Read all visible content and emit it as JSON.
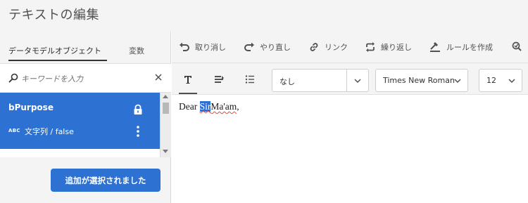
{
  "window": {
    "title": "テキストの編集"
  },
  "left_panel": {
    "tabs": [
      {
        "label": "データモデルオブジェクト",
        "active": true
      },
      {
        "label": "変数",
        "active": false
      }
    ],
    "search": {
      "placeholder": "キーワードを入力",
      "value": ""
    },
    "items": [
      {
        "name": "bPurpose",
        "type_icon": "ABC",
        "type": "文字列 / false",
        "selected": true
      }
    ],
    "add_button": "追加が選択されました"
  },
  "toolbar": {
    "undo": "取り消し",
    "redo": "やり直し",
    "link": "リンク",
    "repeat": "繰り返し",
    "create_rule": "ルールを作成"
  },
  "format_bar": {
    "style_value": "なし",
    "font_value": "Times New Roman",
    "size_value": "12"
  },
  "editor": {
    "before": "Dear ",
    "selected": "Sir",
    "after_misspelled": "Ma'am",
    "after_plain": ","
  },
  "colors": {
    "accent": "#2d72d2",
    "panel_bg": "#f4f4f4",
    "selection": "#2e6fd2",
    "spell_underline": "#e0493b"
  }
}
